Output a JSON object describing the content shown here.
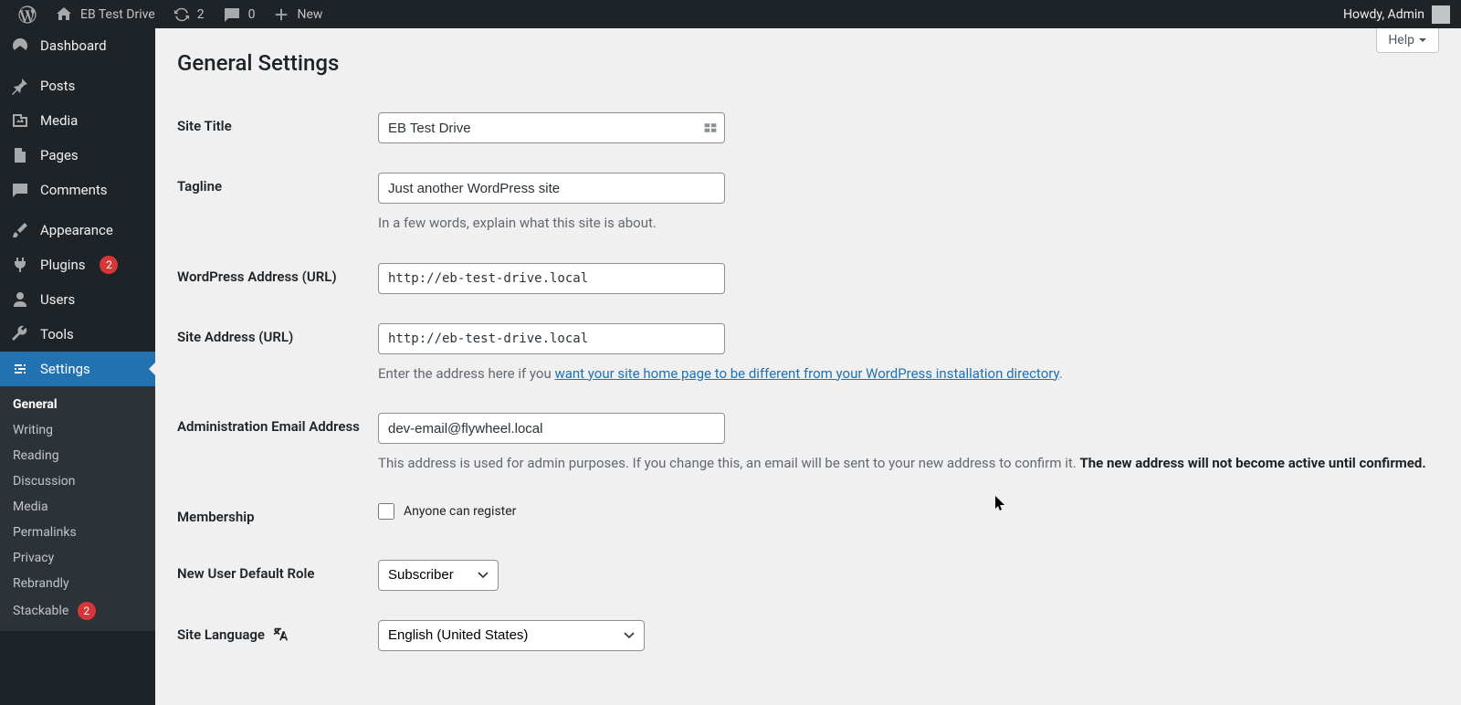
{
  "adminbar": {
    "site_name": "EB Test Drive",
    "updates": "2",
    "comments": "0",
    "new_label": "New",
    "howdy": "Howdy, Admin"
  },
  "sidebar": {
    "items": [
      {
        "id": "dashboard",
        "label": "Dashboard"
      },
      {
        "id": "posts",
        "label": "Posts"
      },
      {
        "id": "media",
        "label": "Media"
      },
      {
        "id": "pages",
        "label": "Pages"
      },
      {
        "id": "comments",
        "label": "Comments"
      },
      {
        "id": "appearance",
        "label": "Appearance"
      },
      {
        "id": "plugins",
        "label": "Plugins",
        "badge": "2"
      },
      {
        "id": "users",
        "label": "Users"
      },
      {
        "id": "tools",
        "label": "Tools"
      },
      {
        "id": "settings",
        "label": "Settings"
      }
    ],
    "submenu": [
      {
        "label": "General",
        "current": true
      },
      {
        "label": "Writing"
      },
      {
        "label": "Reading"
      },
      {
        "label": "Discussion"
      },
      {
        "label": "Media"
      },
      {
        "label": "Permalinks"
      },
      {
        "label": "Privacy"
      },
      {
        "label": "Rebrandly"
      },
      {
        "label": "Stackable",
        "badge": "2"
      }
    ]
  },
  "page": {
    "help": "Help",
    "title": "General Settings"
  },
  "form": {
    "site_title": {
      "label": "Site Title",
      "value": "EB Test Drive"
    },
    "tagline": {
      "label": "Tagline",
      "value": "Just another WordPress site",
      "desc": "In a few words, explain what this site is about."
    },
    "wp_url": {
      "label": "WordPress Address (URL)",
      "value": "http://eb-test-drive.local"
    },
    "site_url": {
      "label": "Site Address (URL)",
      "value": "http://eb-test-drive.local",
      "desc_prefix": "Enter the address here if you ",
      "desc_link": "want your site home page to be different from your WordPress installation directory"
    },
    "admin_email": {
      "label": "Administration Email Address",
      "value": "dev-email@flywheel.local",
      "desc1": "This address is used for admin purposes. If you change this, an email will be sent to your new address to confirm it.",
      "desc_strong": "The new address will not become active until confirmed."
    },
    "membership": {
      "label": "Membership",
      "checkbox_label": "Anyone can register"
    },
    "default_role": {
      "label": "New User Default Role",
      "value": "Subscriber"
    },
    "site_language": {
      "label": "Site Language",
      "value": "English (United States)"
    }
  }
}
